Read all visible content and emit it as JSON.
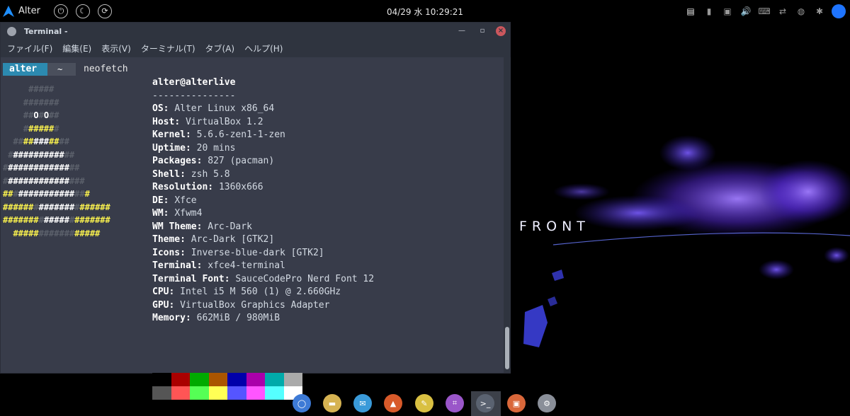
{
  "top_panel": {
    "menu_label": "Alter",
    "clock": "04/29 水 10:29:21",
    "buttons": [
      {
        "name": "power-icon",
        "glyph": "⏻"
      },
      {
        "name": "suspend-icon",
        "glyph": "☾"
      },
      {
        "name": "restart-icon",
        "glyph": "⟳"
      }
    ],
    "tray": [
      {
        "name": "clipboard-icon",
        "glyph": "▤"
      },
      {
        "name": "battery-icon",
        "glyph": "▮"
      },
      {
        "name": "notification-icon",
        "glyph": "▣"
      },
      {
        "name": "volume-icon",
        "glyph": "🔊"
      },
      {
        "name": "keyboard-icon",
        "glyph": "⌨"
      },
      {
        "name": "network-icon",
        "glyph": "⇄"
      },
      {
        "name": "power-manager-icon",
        "glyph": "◍"
      },
      {
        "name": "bluetooth-icon",
        "glyph": "✱"
      }
    ]
  },
  "wallpaper": {
    "text": "FRONT"
  },
  "window": {
    "title": "Terminal -",
    "menu": [
      "ファイル(F)",
      "編集(E)",
      "表示(V)",
      "ターミナル(T)",
      "タブ(A)",
      "ヘルプ(H)"
    ]
  },
  "terminal": {
    "prompt_user": "alter",
    "prompt_dir": "~",
    "command": "neofetch",
    "art": [
      [
        [
          "g",
          "     #####"
        ]
      ],
      [
        [
          "g",
          "    #######"
        ]
      ],
      [
        [
          "g",
          "    ##"
        ],
        [
          "w",
          "O"
        ],
        [
          "g",
          "#"
        ],
        [
          "w",
          "O"
        ],
        [
          "g",
          "##"
        ]
      ],
      [
        [
          "g",
          "    #"
        ],
        [
          "y",
          "#####"
        ],
        [
          "g",
          "#"
        ]
      ],
      [
        [
          "g",
          "  ##"
        ],
        [
          "y",
          "##"
        ],
        [
          "w",
          "###"
        ],
        [
          "y",
          "##"
        ],
        [
          "g",
          "##"
        ]
      ],
      [
        [
          "g",
          " #"
        ],
        [
          "w",
          "##########"
        ],
        [
          "g",
          "##"
        ]
      ],
      [
        [
          "g",
          "#"
        ],
        [
          "w",
          "############"
        ],
        [
          "g",
          "##"
        ]
      ],
      [
        [
          "g",
          "#"
        ],
        [
          "w",
          "############"
        ],
        [
          "g",
          "###"
        ]
      ],
      [
        [
          "y",
          "##"
        ],
        [
          "g",
          "#"
        ],
        [
          "w",
          "###########"
        ],
        [
          "g",
          "##"
        ],
        [
          "y",
          "#"
        ]
      ],
      [
        [
          "y",
          "######"
        ],
        [
          "g",
          "#"
        ],
        [
          "w",
          "#######"
        ],
        [
          "g",
          "#"
        ],
        [
          "y",
          "######"
        ]
      ],
      [
        [
          "y",
          "#######"
        ],
        [
          "g",
          "#"
        ],
        [
          "w",
          "#####"
        ],
        [
          "g",
          "#"
        ],
        [
          "y",
          "#######"
        ]
      ],
      [
        [
          "y",
          "  #####"
        ],
        [
          "g",
          "#######"
        ],
        [
          "y",
          "#####"
        ]
      ]
    ],
    "user_host": "alter@alterlive",
    "separator": "---------------",
    "info": [
      {
        "key": "OS",
        "value": "Alter Linux x86_64"
      },
      {
        "key": "Host",
        "value": "VirtualBox 1.2"
      },
      {
        "key": "Kernel",
        "value": "5.6.6-zen1-1-zen"
      },
      {
        "key": "Uptime",
        "value": "20 mins"
      },
      {
        "key": "Packages",
        "value": "827 (pacman)"
      },
      {
        "key": "Shell",
        "value": "zsh 5.8"
      },
      {
        "key": "Resolution",
        "value": "1360x666"
      },
      {
        "key": "DE",
        "value": "Xfce"
      },
      {
        "key": "WM",
        "value": "Xfwm4"
      },
      {
        "key": "WM Theme",
        "value": "Arc-Dark"
      },
      {
        "key": "Theme",
        "value": "Arc-Dark [GTK2]"
      },
      {
        "key": "Icons",
        "value": "Inverse-blue-dark [GTK2]"
      },
      {
        "key": "Terminal",
        "value": "xfce4-terminal"
      },
      {
        "key": "Terminal Font",
        "value": "SauceCodePro Nerd Font 12"
      },
      {
        "key": "CPU",
        "value": "Intel i5 M 560 (1) @ 2.660GHz"
      },
      {
        "key": "GPU",
        "value": "VirtualBox Graphics Adapter"
      },
      {
        "key": "Memory",
        "value": "662MiB / 980MiB"
      }
    ],
    "palette": {
      "normal": [
        "#000000",
        "#aa0000",
        "#00aa00",
        "#aa5500",
        "#0000aa",
        "#aa00aa",
        "#00aaaa",
        "#aaaaaa"
      ],
      "bright": [
        "#555555",
        "#ff5555",
        "#55ff55",
        "#ffff55",
        "#5555ff",
        "#ff55ff",
        "#55ffff",
        "#ffffff"
      ]
    }
  },
  "dock": [
    {
      "name": "browser-icon",
      "color": "#3d7ad6",
      "glyph": "◯"
    },
    {
      "name": "file-manager-icon",
      "color": "#d6b352",
      "glyph": "▬"
    },
    {
      "name": "mail-icon",
      "color": "#3a9ad9",
      "glyph": "✉"
    },
    {
      "name": "vlc-icon",
      "color": "#d85a2a",
      "glyph": "▲"
    },
    {
      "name": "text-editor-icon",
      "color": "#d9c042",
      "glyph": "✎"
    },
    {
      "name": "screenshot-icon",
      "color": "#9a56c9",
      "glyph": "⌗"
    },
    {
      "name": "terminal-icon",
      "color": "#5a6270",
      "glyph": ">_"
    },
    {
      "name": "app-installer-icon",
      "color": "#d9673a",
      "glyph": "▣"
    },
    {
      "name": "settings-icon",
      "color": "#8a8f99",
      "glyph": "⚙"
    }
  ]
}
